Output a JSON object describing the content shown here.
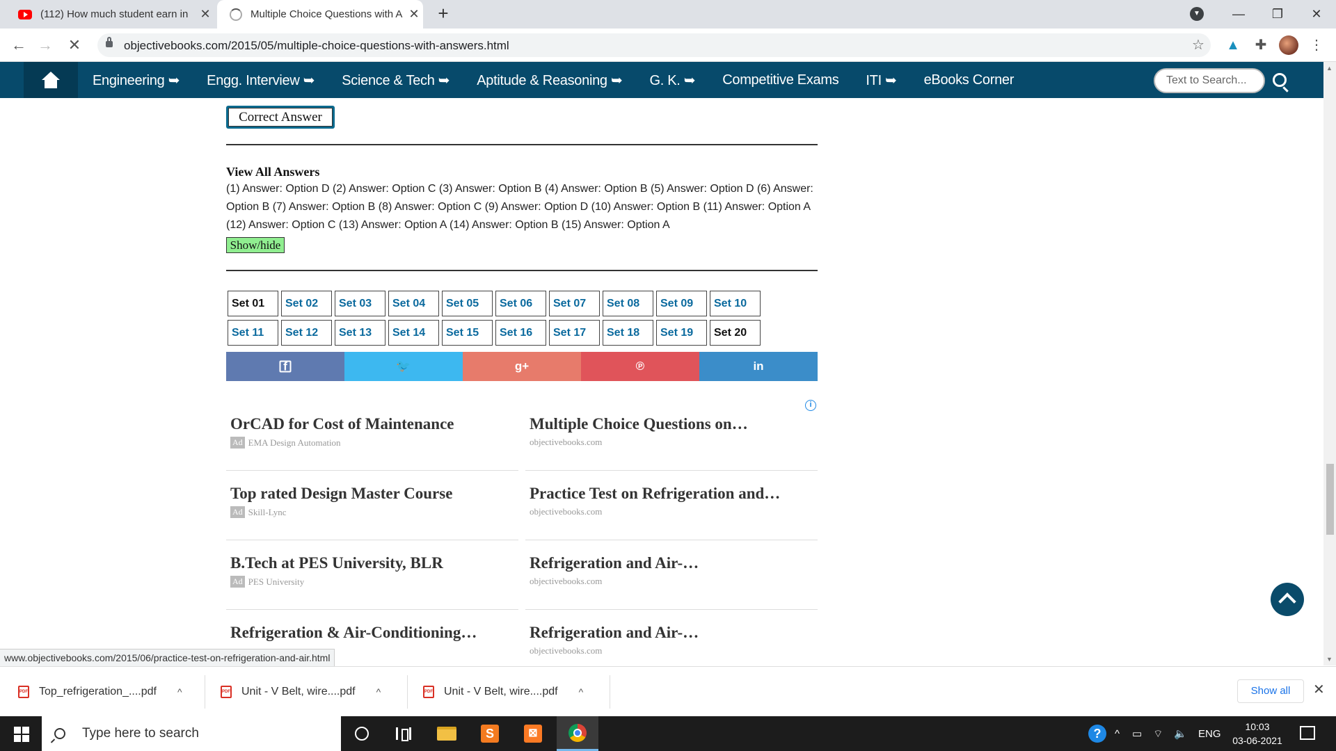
{
  "browser": {
    "tabs": [
      {
        "title": "(112) How much student earn in",
        "icon": "youtube-icon"
      },
      {
        "title": "Multiple Choice Questions with A",
        "icon": "loading-spinner-icon"
      }
    ],
    "url": "objectivebooks.com/2015/05/multiple-choice-questions-with-answers.html",
    "status_url": "www.objectivebooks.com/2015/06/practice-test-on-refrigeration-and-air.html"
  },
  "site_nav": {
    "items": [
      "Engineering ➥",
      "Engg. Interview ➥",
      "Science & Tech ➥",
      "Aptitude & Reasoning ➥",
      "G. K. ➥",
      "Competitive Exams",
      "ITI ➥",
      "eBooks Corner"
    ],
    "search_placeholder": "Text to Search..."
  },
  "content": {
    "correct_answer_label": "Correct Answer",
    "view_all_title": "View All Answers",
    "answers_text": "(1) Answer: Option D (2) Answer: Option C (3) Answer: Option B (4) Answer: Option B (5) Answer: Option D (6) Answer: Option B (7) Answer: Option B (8) Answer: Option C (9) Answer: Option D (10) Answer: Option B (11) Answer: Option A (12) Answer: Option C (13) Answer: Option A (14) Answer: Option B (15) Answer: Option A",
    "show_hide_label": "Show/hide",
    "sets": [
      "Set 01",
      "Set 02",
      "Set 03",
      "Set 04",
      "Set 05",
      "Set 06",
      "Set 07",
      "Set 08",
      "Set 09",
      "Set 10",
      "Set 11",
      "Set 12",
      "Set 13",
      "Set 14",
      "Set 15",
      "Set 16",
      "Set 17",
      "Set 18",
      "Set 19",
      "Set 20"
    ],
    "share_buttons": [
      {
        "name": "facebook",
        "icon": "facebook-icon",
        "glyph": "f",
        "color": "#5f7ab0"
      },
      {
        "name": "twitter",
        "icon": "twitter-icon",
        "glyph": "🐦",
        "color": "#3db8f0"
      },
      {
        "name": "google-plus",
        "icon": "google-plus-icon",
        "glyph": "g+",
        "color": "#e77b6b"
      },
      {
        "name": "pinterest",
        "icon": "pinterest-icon",
        "glyph": "℗",
        "color": "#e0545a"
      },
      {
        "name": "linkedin",
        "icon": "linkedin-icon",
        "glyph": "in",
        "color": "#3b8dc9"
      }
    ],
    "ads": [
      {
        "title": "OrCAD for Cost of Maintenance",
        "source": "EMA Design Automation",
        "is_ad": true
      },
      {
        "title": "Multiple Choice Questions on…",
        "source": "objectivebooks.com",
        "is_ad": false
      },
      {
        "title": "Top rated Design Master Course",
        "source": "Skill-Lync",
        "is_ad": true
      },
      {
        "title": "Practice Test on Refrigeration and…",
        "source": "objectivebooks.com",
        "is_ad": false
      },
      {
        "title": "B.Tech at PES University, BLR",
        "source": "PES University",
        "is_ad": true
      },
      {
        "title": "Refrigeration and Air-…",
        "source": "objectivebooks.com",
        "is_ad": false
      },
      {
        "title": "Refrigeration & Air-Conditioning…",
        "source": "",
        "is_ad": false
      },
      {
        "title": "Refrigeration and Air-…",
        "source": "objectivebooks.com",
        "is_ad": false
      }
    ],
    "ad_badge": "Ad"
  },
  "downloads": {
    "items": [
      "Top_refrigeration_....pdf",
      "Unit - V Belt,  wire....pdf",
      "Unit - V Belt,  wire....pdf"
    ],
    "show_all_label": "Show all"
  },
  "taskbar": {
    "search_placeholder": "Type here to search",
    "language": "ENG",
    "time": "10:03",
    "date": "03-06-2021"
  }
}
